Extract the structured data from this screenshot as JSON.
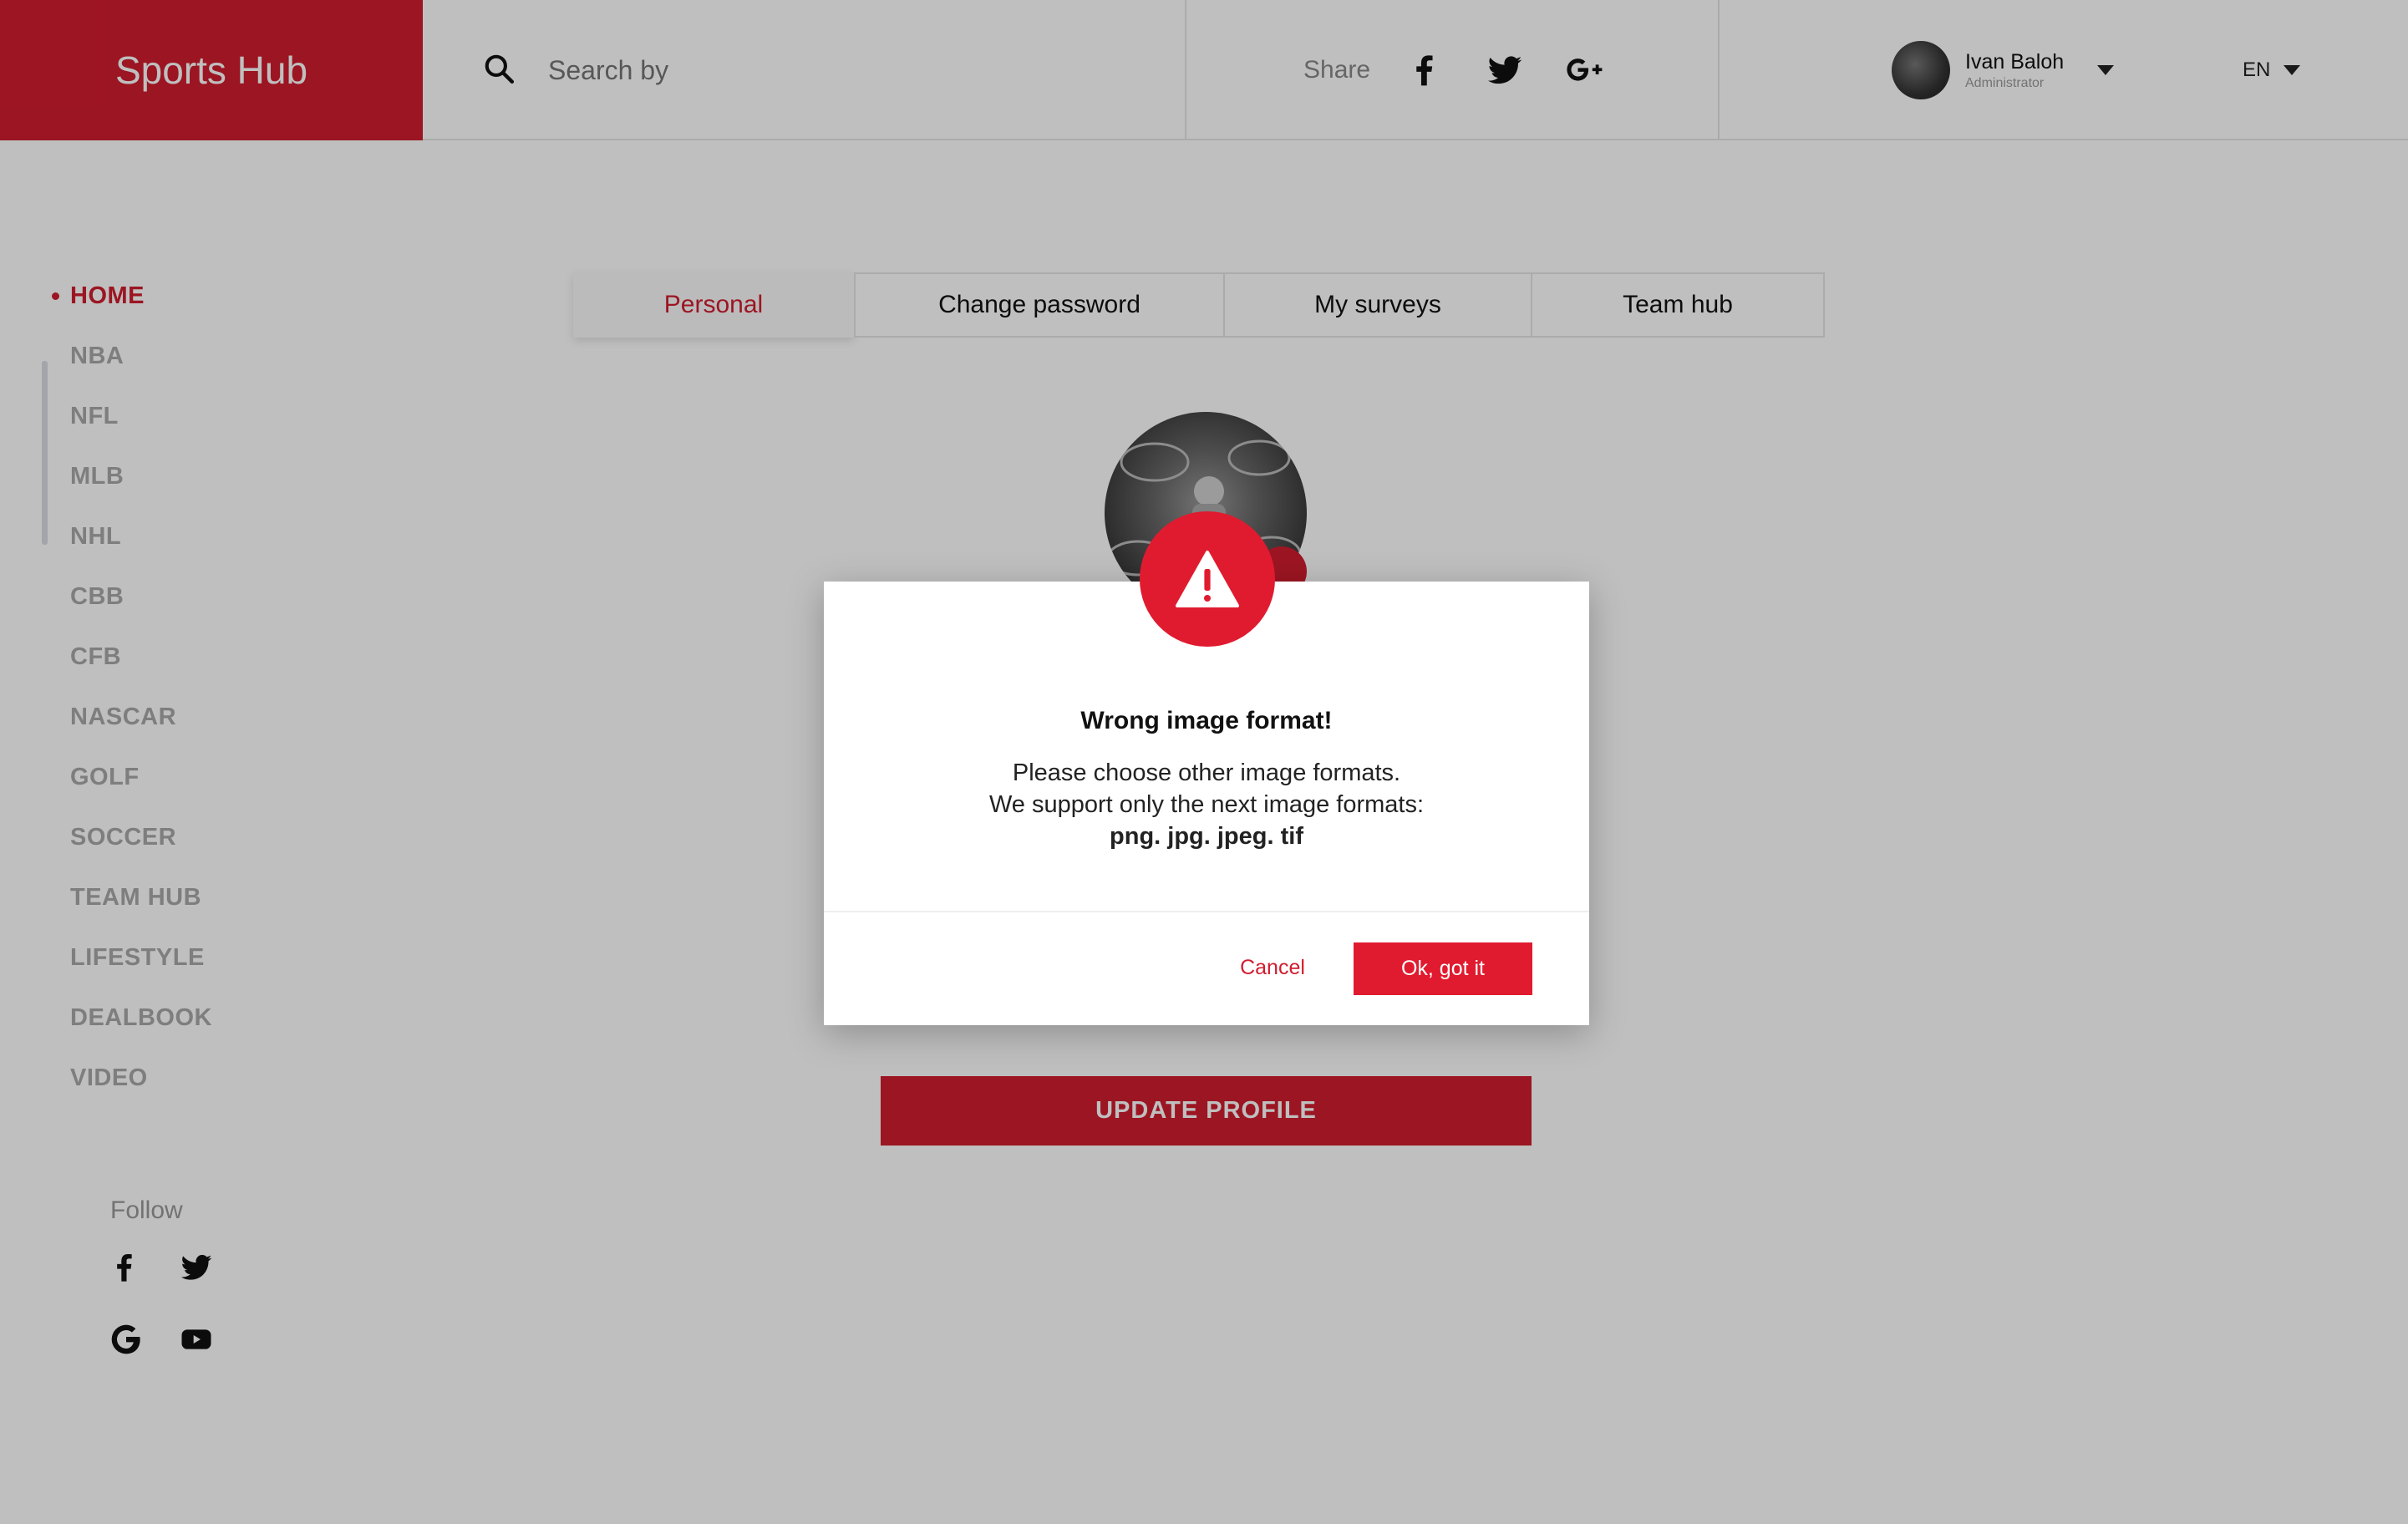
{
  "header": {
    "brand": "Sports Hub",
    "search_placeholder": "Search by",
    "share_label": "Share",
    "user": {
      "name": "Ivan Baloh",
      "role": "Administrator"
    },
    "language": "EN"
  },
  "sidebar": {
    "items": [
      {
        "label": "HOME",
        "active": true
      },
      {
        "label": "NBA"
      },
      {
        "label": "NFL"
      },
      {
        "label": "MLB"
      },
      {
        "label": "NHL"
      },
      {
        "label": "CBB"
      },
      {
        "label": "CFB"
      },
      {
        "label": "NASCAR"
      },
      {
        "label": "GOLF"
      },
      {
        "label": "SOCCER"
      },
      {
        "label": "TEAM HUB"
      },
      {
        "label": "LIFESTYLE"
      },
      {
        "label": "DEALBOOK"
      },
      {
        "label": "VIDEO"
      }
    ],
    "follow_label": "Follow"
  },
  "profile": {
    "tabs": [
      "Personal",
      "Change password",
      "My surveys",
      "Team hub"
    ],
    "active_tab": "Personal",
    "update_button": "UPDATE PROFILE"
  },
  "modal": {
    "title": "Wrong  image format!",
    "line1": "Please choose other image formats.",
    "line2": "We support only the next image formats:",
    "formats": "png. jpg. jpeg. tif",
    "cancel": "Cancel",
    "ok": "Ok, got it"
  },
  "colors": {
    "accent": "#d11c2e",
    "alert": "#e01b2f",
    "overlay": "rgba(0,0,0,0.25)"
  },
  "icons": {
    "search": "search-icon",
    "share": [
      "facebook-icon",
      "twitter-icon",
      "google-plus-icon"
    ],
    "follow": [
      "facebook-icon",
      "twitter-icon",
      "google-icon",
      "youtube-icon"
    ],
    "alert": "warning-icon"
  }
}
